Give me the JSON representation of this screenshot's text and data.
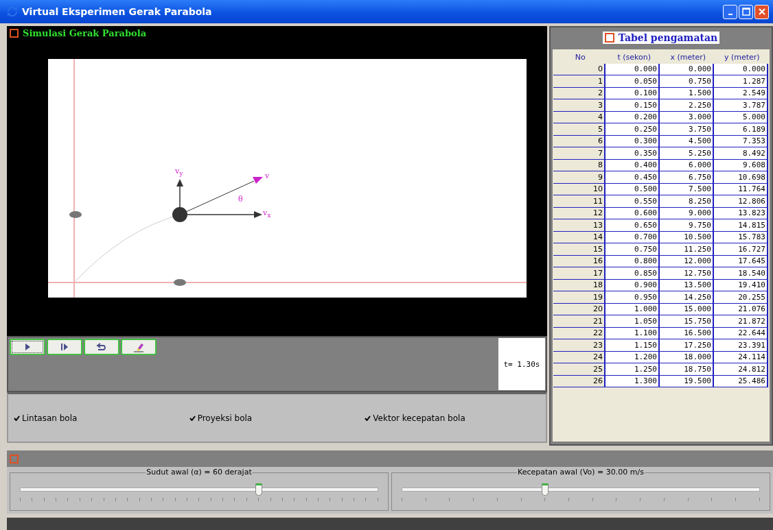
{
  "window": {
    "title": "Virtual Eksperimen Gerak Parabola"
  },
  "simulation": {
    "title": "Simulasi Gerak Parabola",
    "labels": {
      "vy": "v$_{y}$",
      "v": "v",
      "vx": "v$_{x}$",
      "theta": "θ"
    },
    "time": "t= 1.30s"
  },
  "controls": [
    {
      "kind": "play",
      "selected": true
    },
    {
      "kind": "step",
      "selected": false
    },
    {
      "kind": "reset",
      "selected": false
    },
    {
      "kind": "clear",
      "selected": false
    }
  ],
  "options": [
    {
      "label": "Lintasan bola",
      "checked": true
    },
    {
      "label": "Proyeksi bola",
      "checked": true
    },
    {
      "label": "Vektor kecepatan bola",
      "checked": true
    }
  ],
  "table": {
    "title": "Tabel pengamatan",
    "columns": [
      "No",
      "t (sekon)",
      "x (meter)",
      "y (meter)"
    ],
    "rows": [
      [
        "0",
        "0.000",
        "0.000",
        "0.000"
      ],
      [
        "1",
        "0.050",
        "0.750",
        "1.287"
      ],
      [
        "2",
        "0.100",
        "1.500",
        "2.549"
      ],
      [
        "3",
        "0.150",
        "2.250",
        "3.787"
      ],
      [
        "4",
        "0.200",
        "3.000",
        "5.000"
      ],
      [
        "5",
        "0.250",
        "3.750",
        "6.189"
      ],
      [
        "6",
        "0.300",
        "4.500",
        "7.353"
      ],
      [
        "7",
        "0.350",
        "5.250",
        "8.492"
      ],
      [
        "8",
        "0.400",
        "6.000",
        "9.608"
      ],
      [
        "9",
        "0.450",
        "6.750",
        "10.698"
      ],
      [
        "10",
        "0.500",
        "7.500",
        "11.764"
      ],
      [
        "11",
        "0.550",
        "8.250",
        "12.806"
      ],
      [
        "12",
        "0.600",
        "9.000",
        "13.823"
      ],
      [
        "13",
        "0.650",
        "9.750",
        "14.815"
      ],
      [
        "14",
        "0.700",
        "10.500",
        "15.783"
      ],
      [
        "15",
        "0.750",
        "11.250",
        "16.727"
      ],
      [
        "16",
        "0.800",
        "12.000",
        "17.645"
      ],
      [
        "17",
        "0.850",
        "12.750",
        "18.540"
      ],
      [
        "18",
        "0.900",
        "13.500",
        "19.410"
      ],
      [
        "19",
        "0.950",
        "14.250",
        "20.255"
      ],
      [
        "20",
        "1.000",
        "15.000",
        "21.076"
      ],
      [
        "21",
        "1.050",
        "15.750",
        "21.872"
      ],
      [
        "22",
        "1.100",
        "16.500",
        "22.644"
      ],
      [
        "23",
        "1.150",
        "17.250",
        "23.391"
      ],
      [
        "24",
        "1.200",
        "18.000",
        "24.114"
      ],
      [
        "25",
        "1.250",
        "18.750",
        "24.812"
      ],
      [
        "26",
        "1.300",
        "19.500",
        "25.486"
      ]
    ]
  },
  "sliders": [
    {
      "label": "Sudut awal (α) = 60 derajat",
      "level": 0.667
    },
    {
      "label": "Kecepatan awal (Vo) = 30.00 m/s",
      "level": 0.4
    }
  ]
}
